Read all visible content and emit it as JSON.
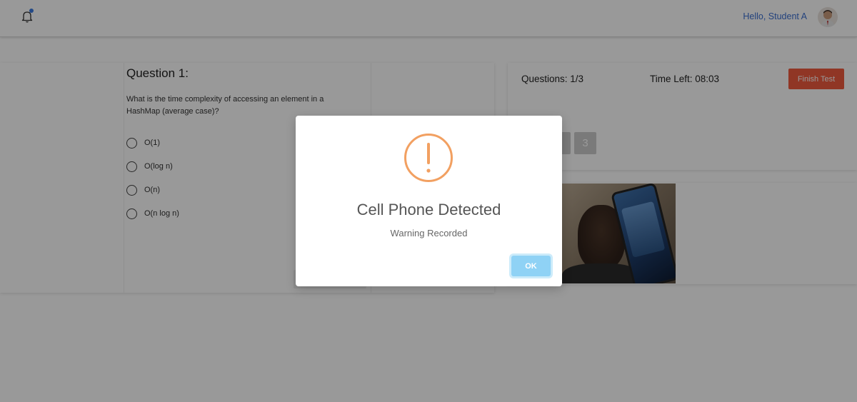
{
  "header": {
    "greeting": "Hello, Student A",
    "notification_icon": "bell-icon",
    "has_unread": true
  },
  "question": {
    "title": "Question 1:",
    "text": "What is the time complexity of accessing an element in a HashMap (average case)?",
    "options": [
      {
        "label": "O(1)",
        "selected": false
      },
      {
        "label": "O(log n)",
        "selected": false
      },
      {
        "label": "O(n)",
        "selected": false
      },
      {
        "label": "O(n log n)",
        "selected": false
      }
    ]
  },
  "status": {
    "questions_label": "Questions: 1/3",
    "time_left_label": "Time Left: 08:03",
    "finish_label": "Finish Test",
    "question_buttons": [
      "3"
    ]
  },
  "modal": {
    "title": "Cell Phone Detected",
    "message": "Warning Recorded",
    "ok_label": "OK",
    "icon": "warning-icon"
  },
  "colors": {
    "accent_blue": "#3b6fd1",
    "finish_red": "#f05a3e",
    "warning_orange": "#f2a061",
    "ok_blue": "#8fd2f5"
  }
}
